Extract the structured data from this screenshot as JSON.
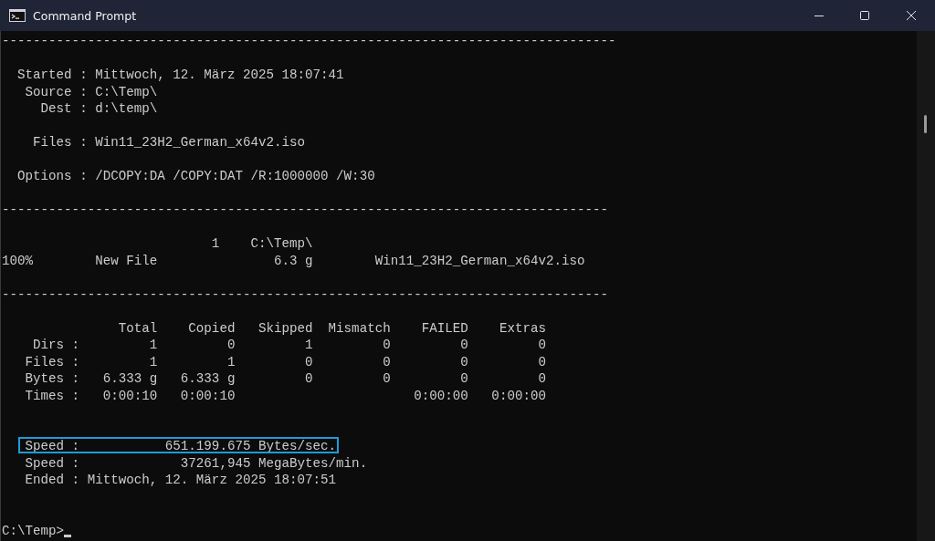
{
  "window": {
    "title": "Command Prompt"
  },
  "console": [
    {
      "kind": "separator",
      "text": "-------------------------------------------------------------------------------"
    },
    {
      "kind": "blank"
    },
    {
      "kind": "text",
      "text": "  Started : Mittwoch, 12. März 2025 18:07:41"
    },
    {
      "kind": "text",
      "text": "   Source : C:\\Temp\\"
    },
    {
      "kind": "text",
      "text": "     Dest : d:\\temp\\"
    },
    {
      "kind": "blank"
    },
    {
      "kind": "text",
      "text": "    Files : Win11_23H2_German_x64v2.iso"
    },
    {
      "kind": "blank"
    },
    {
      "kind": "text",
      "text": "  Options : /DCOPY:DA /COPY:DAT /R:1000000 /W:30"
    },
    {
      "kind": "blank"
    },
    {
      "kind": "separator",
      "text": "------------------------------------------------------------------------------"
    },
    {
      "kind": "blank"
    },
    {
      "kind": "text",
      "text": "                           1    C:\\Temp\\"
    },
    {
      "kind": "text",
      "text": "100%        New File               6.3 g        Win11_23H2_German_x64v2.iso"
    },
    {
      "kind": "blank"
    },
    {
      "kind": "separator",
      "text": "------------------------------------------------------------------------------"
    },
    {
      "kind": "blank"
    },
    {
      "kind": "text",
      "text": "               Total    Copied   Skipped  Mismatch    FAILED    Extras"
    },
    {
      "kind": "text",
      "text": "    Dirs :         1         0         1         0         0         0"
    },
    {
      "kind": "text",
      "text": "   Files :         1         1         0         0         0         0"
    },
    {
      "kind": "text",
      "text": "   Bytes :   6.333 g   6.333 g         0         0         0         0"
    },
    {
      "kind": "text",
      "text": "   Times :   0:00:10   0:00:10                       0:00:00   0:00:00"
    },
    {
      "kind": "blank"
    },
    {
      "kind": "blank"
    },
    {
      "kind": "text",
      "text": "   Speed :           651.199.675 Bytes/sec.",
      "highlighted": true
    },
    {
      "kind": "text",
      "text": "   Speed :             37261,945 MegaBytes/min."
    },
    {
      "kind": "text",
      "text": "   Ended : Mittwoch, 12. März 2025 18:07:51"
    },
    {
      "kind": "blank"
    },
    {
      "kind": "blank"
    },
    {
      "kind": "prompt",
      "text": "C:\\Temp>"
    }
  ]
}
